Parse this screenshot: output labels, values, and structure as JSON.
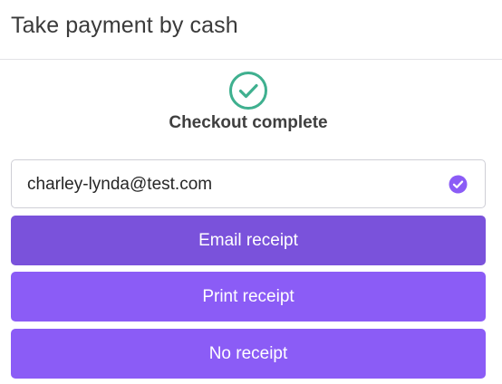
{
  "header": {
    "title": "Take payment by cash"
  },
  "status": {
    "icon": "check-circle-icon",
    "text": "Checkout complete",
    "color": "#3fb08f"
  },
  "email_field": {
    "value": "charley-lynda@test.com",
    "valid_icon": "check-badge-icon"
  },
  "buttons": {
    "email_receipt": "Email receipt",
    "print_receipt": "Print receipt",
    "no_receipt": "No receipt"
  },
  "colors": {
    "accent": "#8b5cf6",
    "accent_active": "#7a52db",
    "success": "#3fb08f"
  }
}
